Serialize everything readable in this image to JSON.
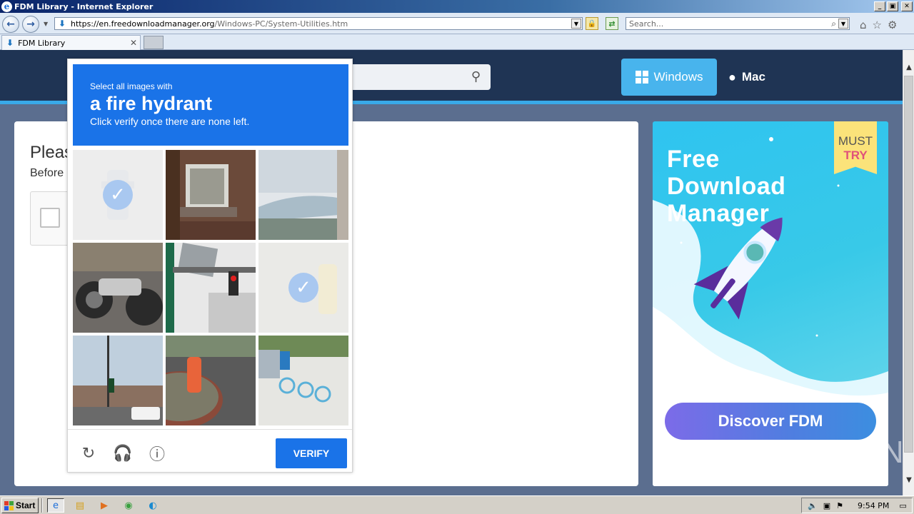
{
  "window": {
    "title": "FDM Library - Internet Explorer",
    "min": "_",
    "max": "▣",
    "close": "✕"
  },
  "browser": {
    "url_main": "https://en.freedownloadmanager.org",
    "url_path": "/Windows-PC/System-Utilities.htm",
    "search_placeholder": "Search...",
    "tab_title": "FDM Library",
    "tab_close": "✕"
  },
  "site": {
    "windows_label": "Windows",
    "mac_label": "Mac",
    "content_title": "Pleas",
    "content_sub": "Before"
  },
  "captcha": {
    "line1": "Select all images with",
    "line2": "a fire hydrant",
    "line3": "Click verify once there are none left.",
    "verify_label": "VERIFY",
    "tiles": [
      {
        "subject": "fire hydrant",
        "selected": true
      },
      {
        "subject": "building balcony",
        "selected": false
      },
      {
        "subject": "street overpass",
        "selected": false
      },
      {
        "subject": "motorcycle",
        "selected": false
      },
      {
        "subject": "traffic light and sign",
        "selected": false
      },
      {
        "subject": "fire hydrant",
        "selected": true
      },
      {
        "subject": "street intersection",
        "selected": false
      },
      {
        "subject": "fire hydrant on curb",
        "selected": false
      },
      {
        "subject": "bicycles",
        "selected": false
      }
    ]
  },
  "ad": {
    "title": "Free Download Manager",
    "must": "MUST",
    "try": "TRY",
    "button": "Discover FDM"
  },
  "watermark": "ANY▷RUN",
  "taskbar": {
    "start_label": "Start",
    "clock": "9:54 PM"
  },
  "colors": {
    "header_bg": "#1f3454",
    "accent_blue": "#48b4ed",
    "captcha_blue": "#1a73e8",
    "ad_bg": "#2fc4f0"
  }
}
